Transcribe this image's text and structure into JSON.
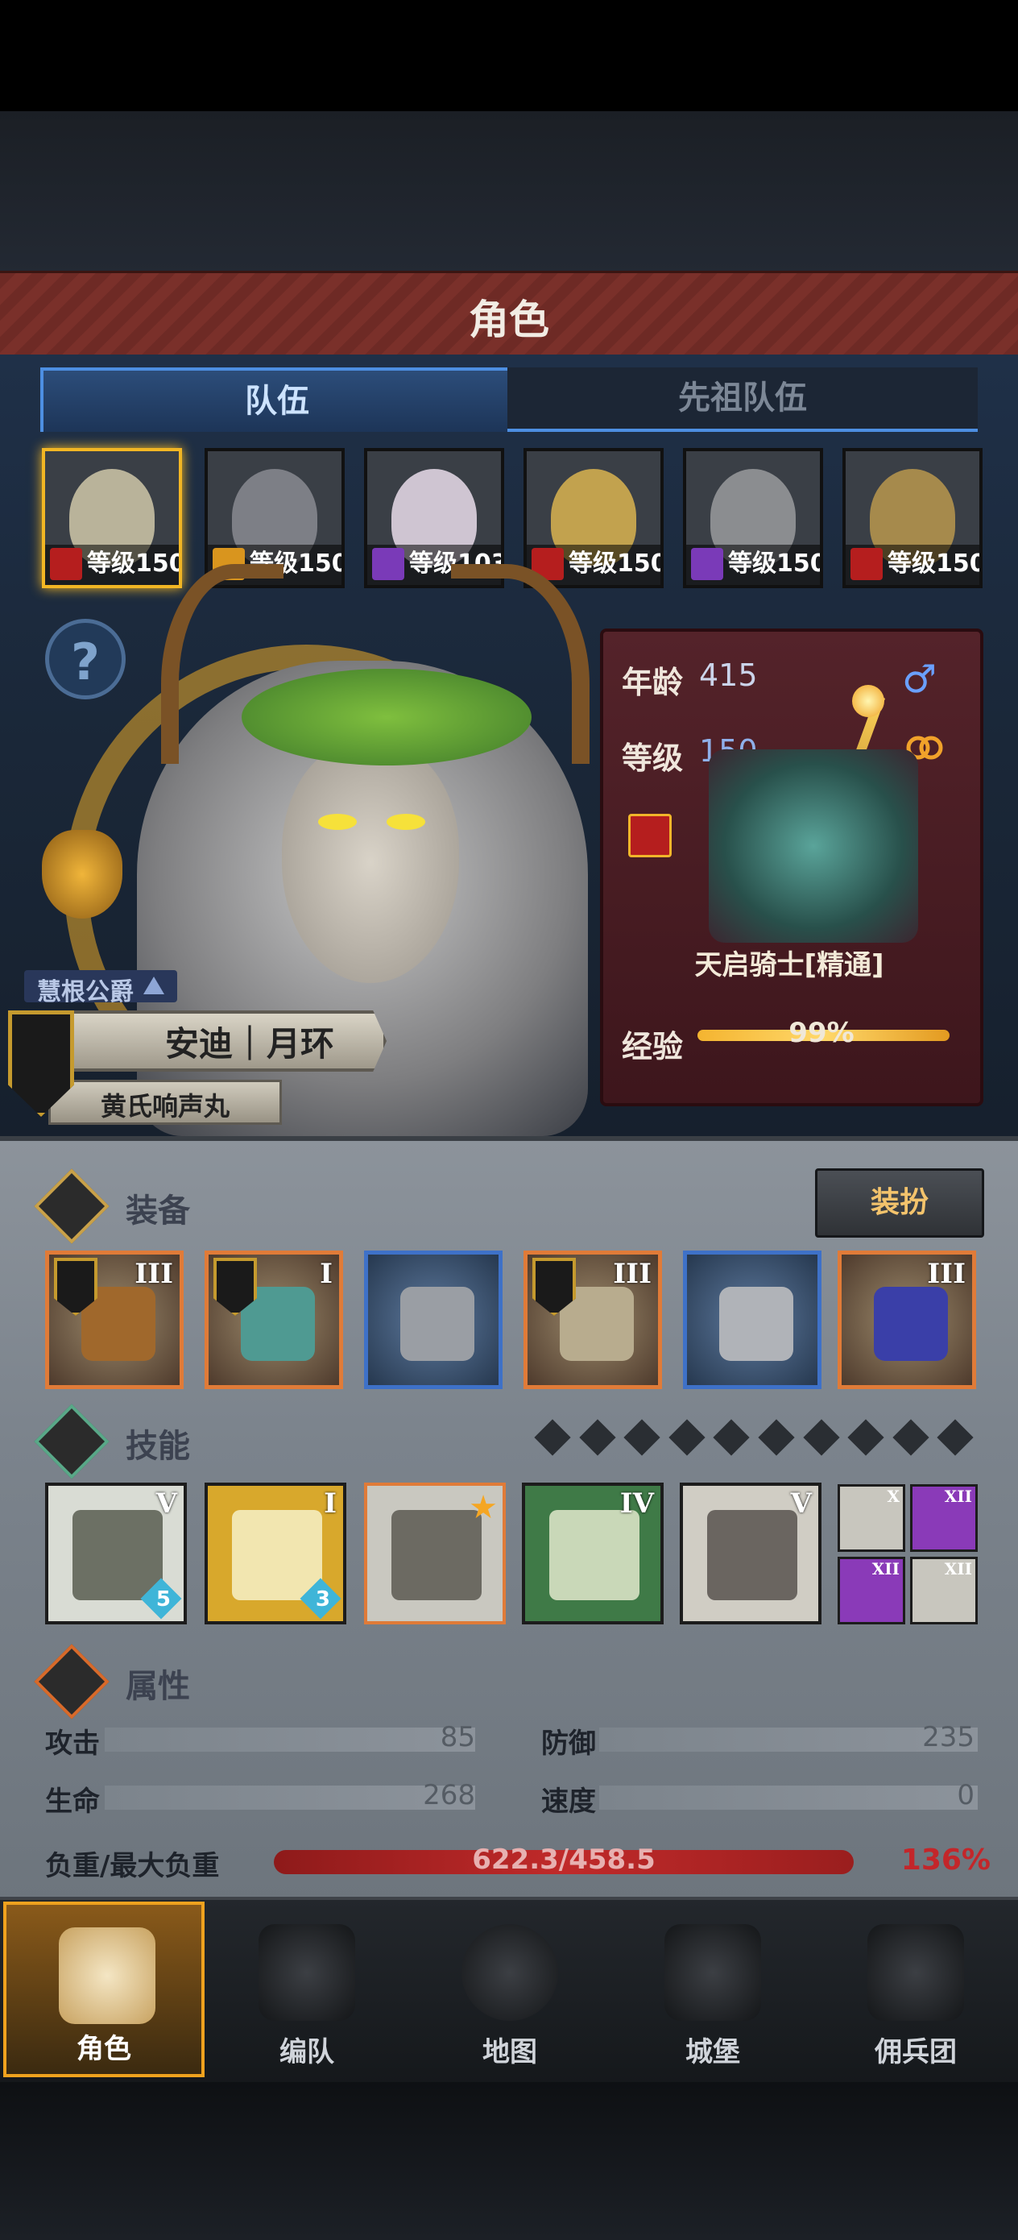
{
  "header": {
    "title": "角色"
  },
  "tabs": [
    {
      "label": "队伍",
      "active": true
    },
    {
      "label": "先祖队伍",
      "active": false
    }
  ],
  "party": [
    {
      "level": "等级150",
      "class_color": "#b51e1e",
      "face": "#b9b39a",
      "selected": true
    },
    {
      "level": "等级150",
      "class_color": "#d9951e",
      "face": "#7d7f86",
      "selected": false
    },
    {
      "level": "等级103",
      "class_color": "#7a3ab8",
      "face": "#cfc5d2",
      "selected": false
    },
    {
      "level": "等级150",
      "class_color": "#b51e1e",
      "face": "#c2a24e",
      "selected": false
    },
    {
      "level": "等级150",
      "class_color": "#7a3ab8",
      "face": "#8b8d90",
      "selected": false
    },
    {
      "level": "等级150",
      "class_color": "#b51e1e",
      "face": "#a68a4c",
      "selected": false
    }
  ],
  "hero": {
    "title": "慧根公爵",
    "name": "安迪｜月环",
    "subtitle": "黄氏响声丸"
  },
  "info": {
    "age_label": "年龄",
    "age_value": "415",
    "gender_icon": "♂",
    "level_label": "等级",
    "level_value": "150",
    "class_name": "天启骑士[精通]",
    "exp_label": "经验",
    "exp_value": "99%",
    "exp_fraction": 0.99
  },
  "equipment": {
    "title": "装备",
    "dress_button": "装扮",
    "slots": [
      {
        "tier": "III",
        "crest": true,
        "rarity": "orange",
        "art": "#a0682c"
      },
      {
        "tier": "I",
        "crest": true,
        "rarity": "orange",
        "art": "#4f9a92"
      },
      {
        "tier": "",
        "crest": false,
        "rarity": "blue",
        "art": "#9a9ea4"
      },
      {
        "tier": "III",
        "crest": true,
        "rarity": "orange",
        "art": "#b8ac8e"
      },
      {
        "tier": "",
        "crest": false,
        "rarity": "blue",
        "art": "#b0b3b8"
      },
      {
        "tier": "III",
        "crest": false,
        "rarity": "orange",
        "art": "#3a3fa8"
      }
    ]
  },
  "skills": {
    "title": "技能",
    "slot_count": 10,
    "main": [
      {
        "tier": "V",
        "gem": "5",
        "bg": "#d9dcd4",
        "art": "#6c7064",
        "border": "#1c1c1c",
        "star": false
      },
      {
        "tier": "I",
        "gem": "3",
        "bg": "#d8a82c",
        "art": "#f2e6b0",
        "border": "#1c1c1c",
        "star": false
      },
      {
        "tier": "",
        "gem": "",
        "bg": "#c9c8c0",
        "art": "#6c6a62",
        "border": "#e07b38",
        "star": true
      },
      {
        "tier": "IV",
        "gem": "",
        "bg": "#3f7a47",
        "art": "#c9d8b8",
        "border": "#1c1c1c",
        "star": false
      },
      {
        "tier": "V",
        "gem": "",
        "bg": "#d0cdc4",
        "art": "#6a6560",
        "border": "#1c1c1c",
        "star": false
      }
    ],
    "mini": [
      {
        "tier": "X",
        "bg": "#c8c6be"
      },
      {
        "tier": "XII",
        "bg": "#8a3ab8"
      },
      {
        "tier": "XII",
        "bg": "#8a3ab8"
      },
      {
        "tier": "XII",
        "bg": "#c8c6be"
      }
    ]
  },
  "attributes": {
    "title": "属性",
    "attack_label": "攻击",
    "attack_value": "85",
    "defense_label": "防御",
    "defense_value": "235",
    "hp_label": "生命",
    "hp_value": "268",
    "speed_label": "速度",
    "speed_value": "0",
    "load_label": "负重/最大负重",
    "load_value": "622.3/458.5",
    "load_pct": "136%"
  },
  "nav": [
    {
      "label": "角色",
      "selected": true
    },
    {
      "label": "编队",
      "selected": false
    },
    {
      "label": "地图",
      "selected": false
    },
    {
      "label": "城堡",
      "selected": false
    },
    {
      "label": "佣兵团",
      "selected": false
    }
  ],
  "colors": {
    "accent_gold": "#f2b624",
    "tab_blue": "#4d8fe2",
    "load_red": "#c3262a"
  }
}
